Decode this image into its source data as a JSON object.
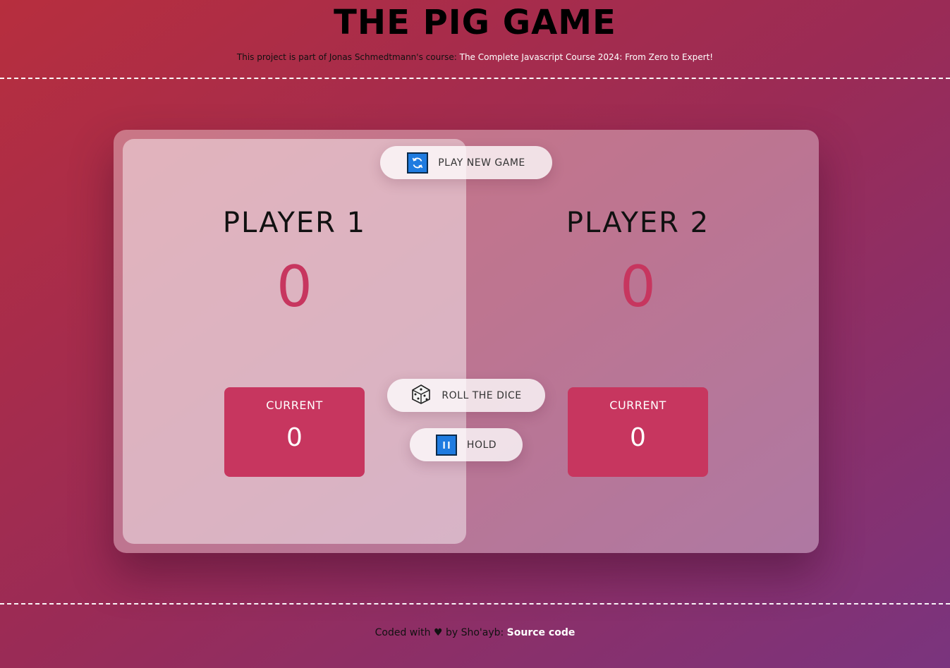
{
  "header": {
    "title": "THE PIG GAME",
    "subtitle_prefix": "This project is part of Jonas Schmedtmann's course: ",
    "course_link": "The Complete Javascript Course 2024: From Zero to Expert!"
  },
  "buttons": {
    "new_game": "PLAY NEW GAME",
    "new_game_icon": "refresh-icon",
    "roll": "ROLL THE DICE",
    "roll_icon": "dice-icon",
    "hold": "HOLD",
    "hold_icon": "pause-icon"
  },
  "players": [
    {
      "name": "PLAYER 1",
      "score": "0",
      "current_label": "CURRENT",
      "current_score": "0",
      "active": true
    },
    {
      "name": "PLAYER 2",
      "score": "0",
      "current_label": "CURRENT",
      "current_score": "0",
      "active": false
    }
  ],
  "footer": {
    "prefix": "Coded with ♥ by Sho'ayb: ",
    "source_link": "Source code"
  },
  "colors": {
    "accent": "#c7365f",
    "icon_blue": "#1f7be0"
  }
}
